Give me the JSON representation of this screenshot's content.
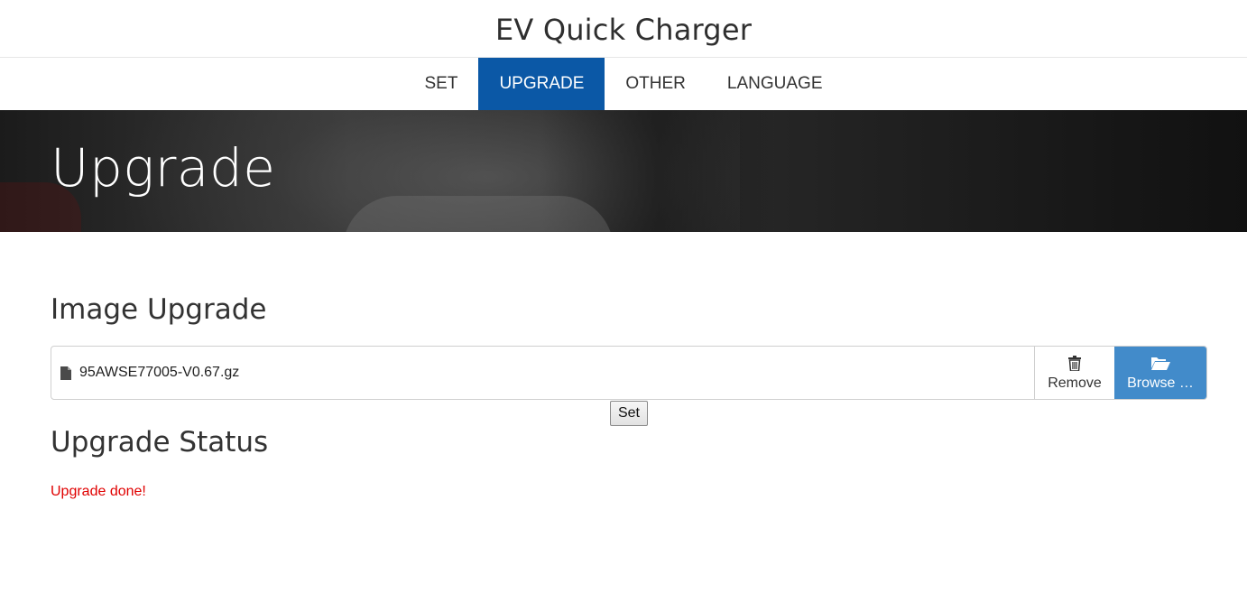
{
  "header": {
    "title": "EV Quick Charger"
  },
  "nav": {
    "items": [
      {
        "label": "SET",
        "active": false
      },
      {
        "label": "UPGRADE",
        "active": true
      },
      {
        "label": "OTHER",
        "active": false
      },
      {
        "label": "LANGUAGE",
        "active": false
      }
    ]
  },
  "hero": {
    "title": "Upgrade"
  },
  "image_upgrade": {
    "title": "Image Upgrade",
    "file_name": "95AWSE77005-V0.67.gz",
    "remove_label": "Remove",
    "browse_label": "Browse …",
    "set_label": "Set"
  },
  "upgrade_status": {
    "title": "Upgrade Status",
    "message": "Upgrade done!"
  },
  "colors": {
    "nav_active": "#0b58a6",
    "browse_button": "#428bca",
    "status_text": "#e00000"
  },
  "icons": {
    "file": "file-icon",
    "remove": "trash-icon",
    "browse": "folder-open-icon"
  }
}
